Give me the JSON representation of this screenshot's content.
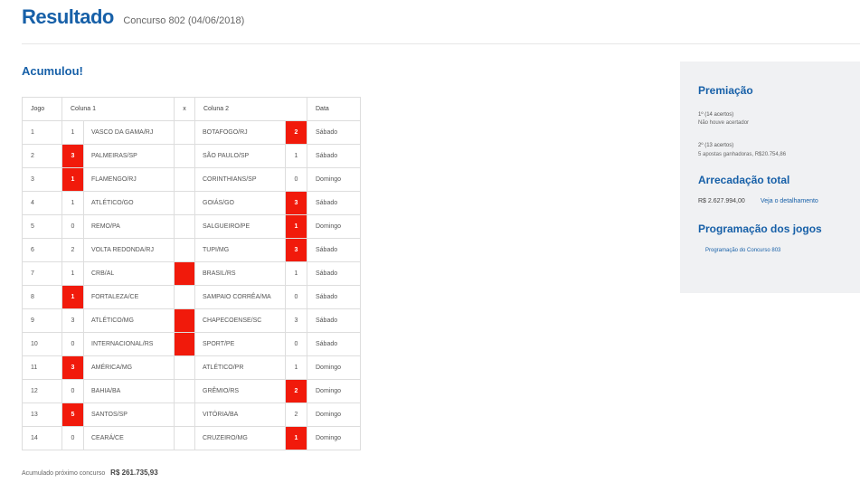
{
  "header": {
    "title": "Resultado",
    "subtitle": "Concurso 802 (04/06/2018)"
  },
  "status": "Acumulou!",
  "table": {
    "headers": {
      "jogo": "Jogo",
      "col1": "Coluna 1",
      "x": "x",
      "col2": "Coluna 2",
      "data": "Data"
    },
    "rows": [
      {
        "jogo": "1",
        "s1": "1",
        "t1": "VASCO DA GAMA/RJ",
        "x": "",
        "t2": "BOTAFOGO/RJ",
        "s2": "2",
        "data": "Sábado",
        "win": "2"
      },
      {
        "jogo": "2",
        "s1": "3",
        "t1": "PALMEIRAS/SP",
        "x": "",
        "t2": "SÃO PAULO/SP",
        "s2": "1",
        "data": "Sábado",
        "win": "1"
      },
      {
        "jogo": "3",
        "s1": "1",
        "t1": "FLAMENGO/RJ",
        "x": "",
        "t2": "CORINTHIANS/SP",
        "s2": "0",
        "data": "Domingo",
        "win": "1"
      },
      {
        "jogo": "4",
        "s1": "1",
        "t1": "ATLÉTICO/GO",
        "x": "",
        "t2": "GOIÁS/GO",
        "s2": "3",
        "data": "Sábado",
        "win": "2"
      },
      {
        "jogo": "5",
        "s1": "0",
        "t1": "REMO/PA",
        "x": "",
        "t2": "SALGUEIRO/PE",
        "s2": "1",
        "data": "Domingo",
        "win": "2"
      },
      {
        "jogo": "6",
        "s1": "2",
        "t1": "VOLTA REDONDA/RJ",
        "x": "",
        "t2": "TUPI/MG",
        "s2": "3",
        "data": "Sábado",
        "win": "2"
      },
      {
        "jogo": "7",
        "s1": "1",
        "t1": "CRB/AL",
        "x": "",
        "t2": "BRASIL/RS",
        "s2": "1",
        "data": "Sábado",
        "win": "x"
      },
      {
        "jogo": "8",
        "s1": "1",
        "t1": "FORTALEZA/CE",
        "x": "",
        "t2": "SAMPAIO CORRÊA/MA",
        "s2": "0",
        "data": "Sábado",
        "win": "1"
      },
      {
        "jogo": "9",
        "s1": "3",
        "t1": "ATLÉTICO/MG",
        "x": "",
        "t2": "CHAPECOENSE/SC",
        "s2": "3",
        "data": "Sábado",
        "win": "x"
      },
      {
        "jogo": "10",
        "s1": "0",
        "t1": "INTERNACIONAL/RS",
        "x": "",
        "t2": "SPORT/PE",
        "s2": "0",
        "data": "Sábado",
        "win": "x"
      },
      {
        "jogo": "11",
        "s1": "3",
        "t1": "AMÉRICA/MG",
        "x": "",
        "t2": "ATLÉTICO/PR",
        "s2": "1",
        "data": "Domingo",
        "win": "1"
      },
      {
        "jogo": "12",
        "s1": "0",
        "t1": "BAHIA/BA",
        "x": "",
        "t2": "GRÊMIO/RS",
        "s2": "2",
        "data": "Domingo",
        "win": "2"
      },
      {
        "jogo": "13",
        "s1": "5",
        "t1": "SANTOS/SP",
        "x": "",
        "t2": "VITÓRIA/BA",
        "s2": "2",
        "data": "Domingo",
        "win": "1"
      },
      {
        "jogo": "14",
        "s1": "0",
        "t1": "CEARÁ/CE",
        "x": "",
        "t2": "CRUZEIRO/MG",
        "s2": "1",
        "data": "Domingo",
        "win": "2"
      }
    ]
  },
  "footer": {
    "label": "Acumulado próximo concurso",
    "value": "R$ 261.735,93"
  },
  "sidebar": {
    "premiacao": {
      "title": "Premiação",
      "first_label": "1º (14 acertos)",
      "first_value": "Não houve acertador",
      "second_label": "2º (13 acertos)",
      "second_value": "5 apostas ganhadoras, R$20.754,86"
    },
    "arrecadacao": {
      "title": "Arrecadação total",
      "value": "R$ 2.627.994,00",
      "link": "Veja o detalhamento"
    },
    "programacao": {
      "title": "Programação dos jogos",
      "link": "Programação do Concurso 803"
    }
  },
  "colors": {
    "brand": "#1760a8",
    "highlight": "#f11a0b",
    "sidebar_bg": "#f0f1f3"
  }
}
